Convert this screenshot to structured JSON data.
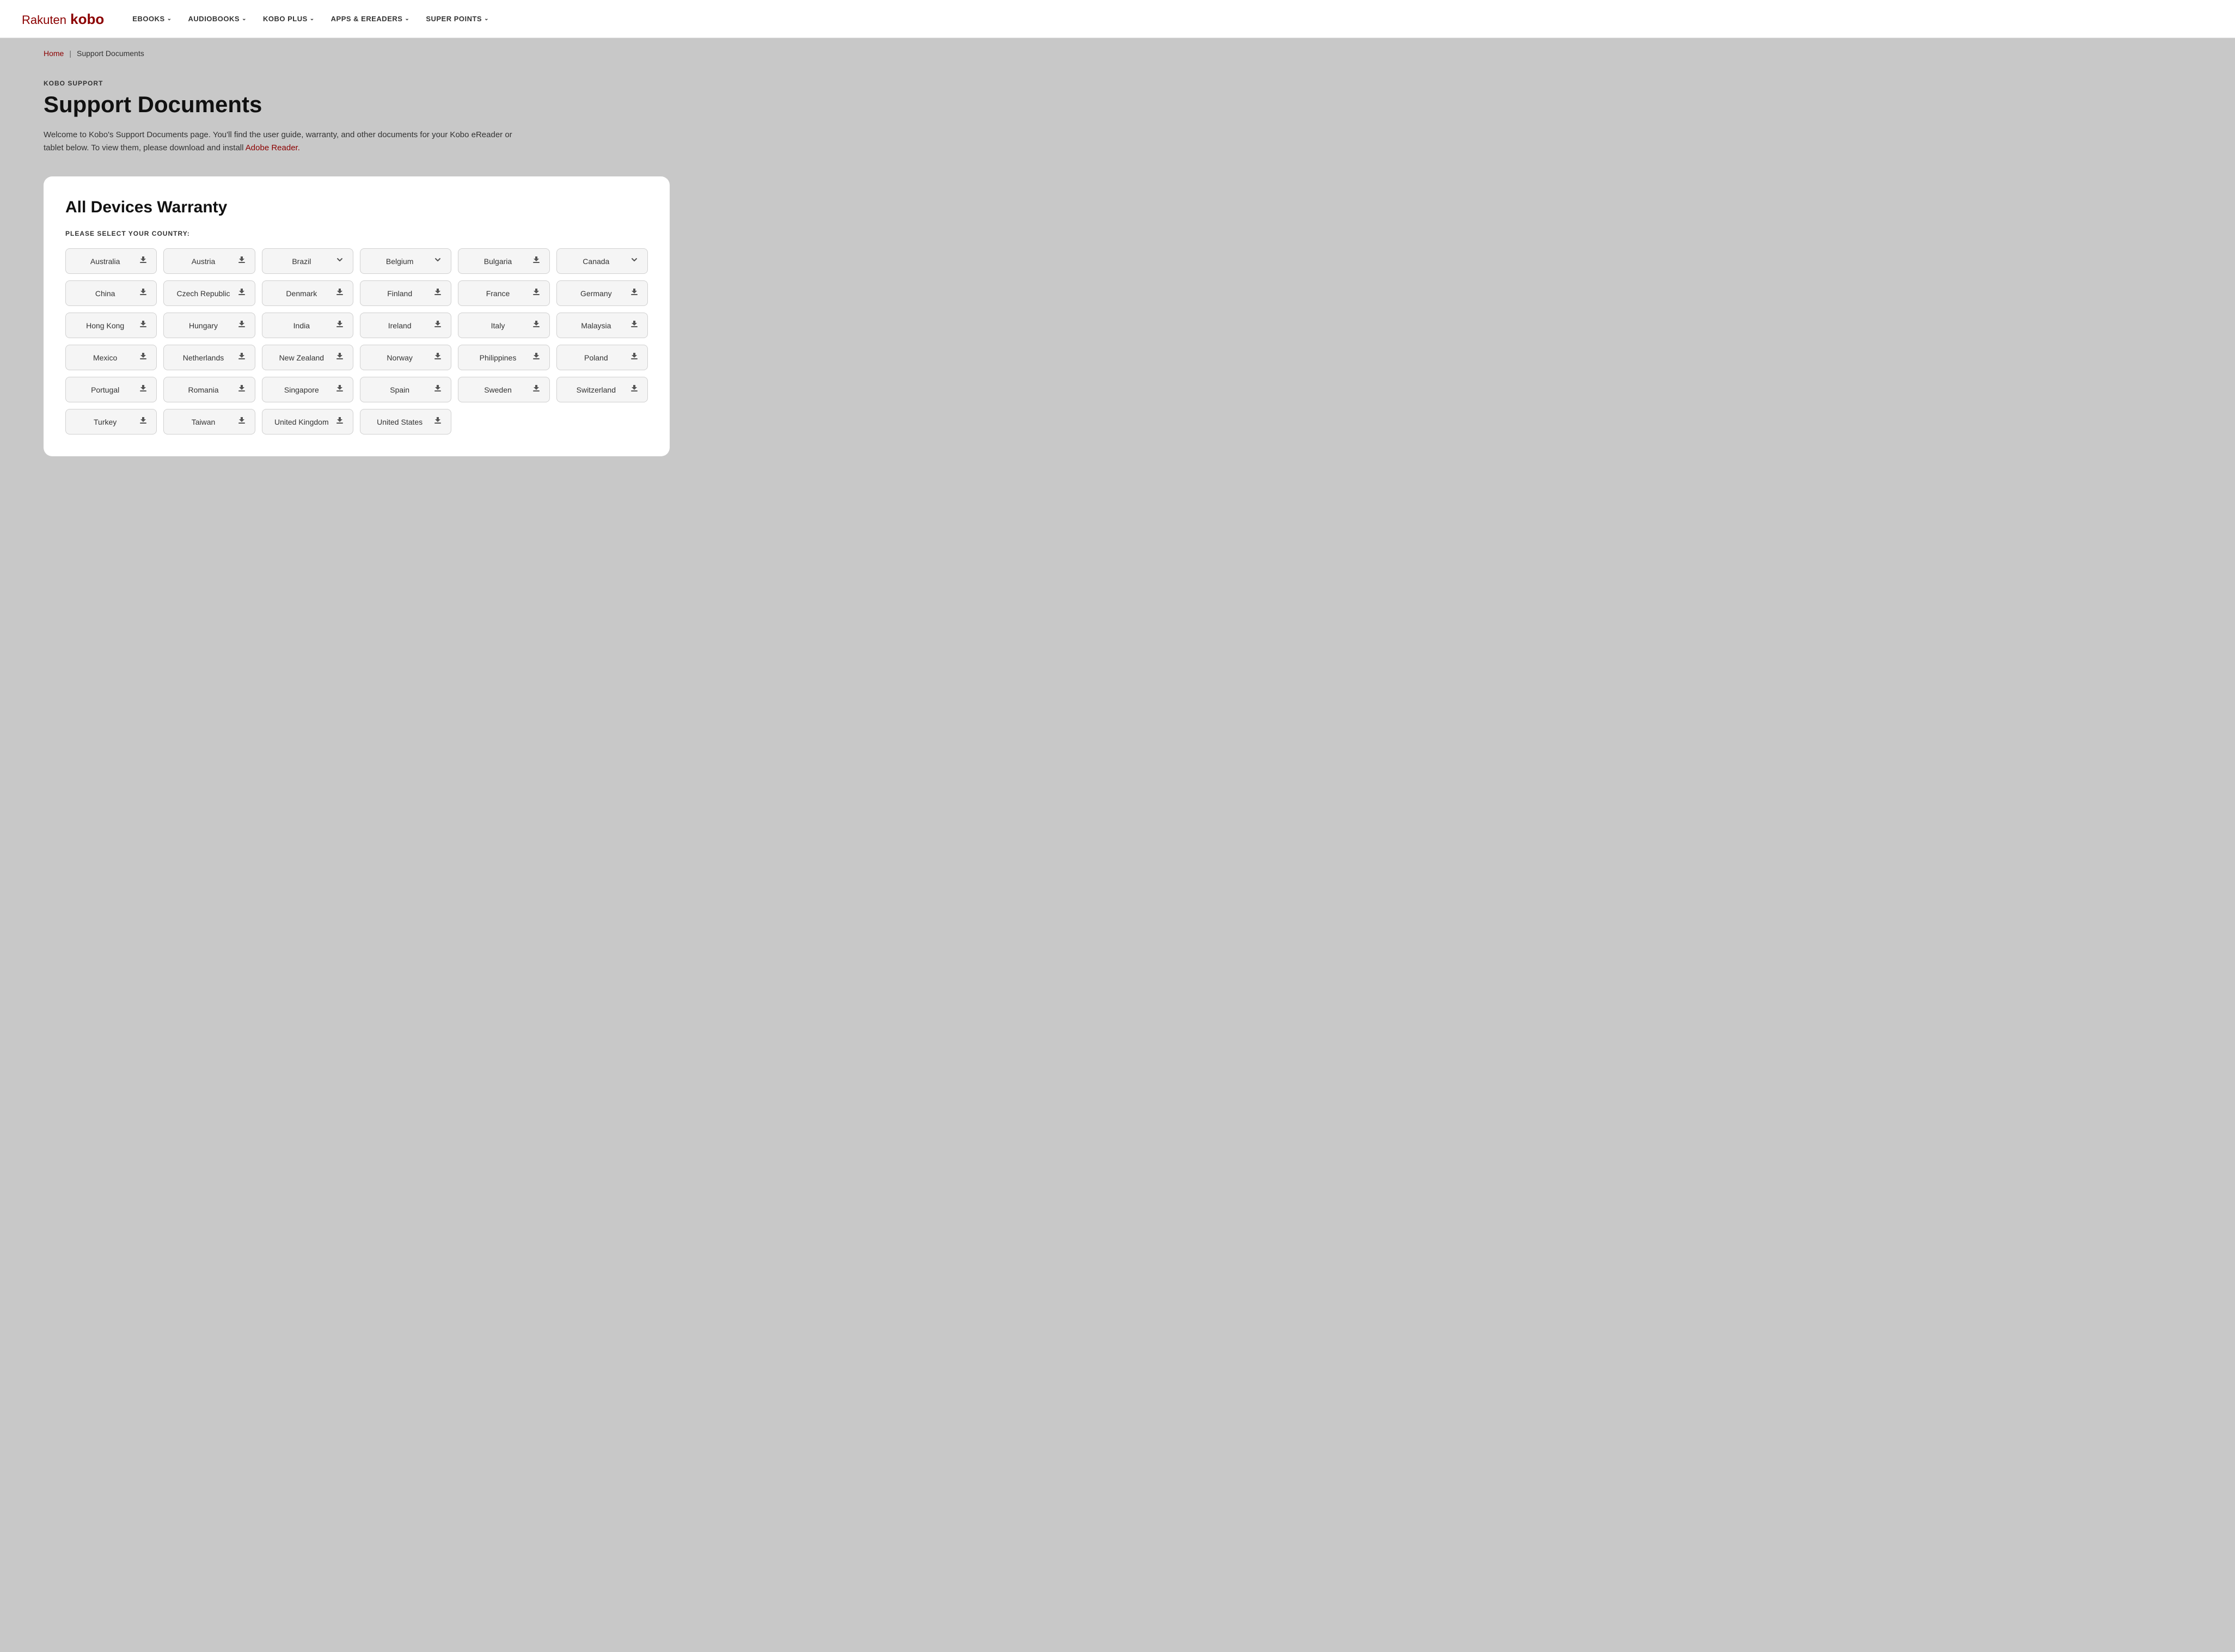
{
  "header": {
    "logo": "Rakuten kobo",
    "logo_rakuten": "Rakuten",
    "logo_kobo": "kobo",
    "nav": [
      {
        "label": "eBOOKS",
        "has_arrow": true
      },
      {
        "label": "AUDIOBOOKS",
        "has_arrow": true
      },
      {
        "label": "KOBO PLUS",
        "has_arrow": true
      },
      {
        "label": "APPS & eREADERS",
        "has_arrow": true
      },
      {
        "label": "SUPER POINTS",
        "has_arrow": true
      }
    ]
  },
  "breadcrumb": {
    "home": "Home",
    "separator": "|",
    "current": "Support Documents"
  },
  "page": {
    "subtitle": "KOBO SUPPORT",
    "title": "Support Documents",
    "description_part1": "Welcome to Kobo's Support Documents page. You'll find the user guide, warranty, and other documents for your Kobo eReader or tablet below. To view them, please download and install ",
    "description_link": "Adobe Reader.",
    "description_part2": ""
  },
  "card": {
    "title": "All Devices Warranty",
    "select_label": "PLEASE SELECT YOUR COUNTRY:",
    "countries": [
      {
        "name": "Australia",
        "icon": "download"
      },
      {
        "name": "Austria",
        "icon": "download"
      },
      {
        "name": "Brazil",
        "icon": "chevron-down"
      },
      {
        "name": "Belgium",
        "icon": "chevron-down"
      },
      {
        "name": "Bulgaria",
        "icon": "download"
      },
      {
        "name": "Canada",
        "icon": "chevron-down"
      },
      {
        "name": "China",
        "icon": "download"
      },
      {
        "name": "Czech Republic",
        "icon": "download"
      },
      {
        "name": "Denmark",
        "icon": "download"
      },
      {
        "name": "Finland",
        "icon": "download"
      },
      {
        "name": "France",
        "icon": "download"
      },
      {
        "name": "Germany",
        "icon": "download"
      },
      {
        "name": "Hong Kong",
        "icon": "download"
      },
      {
        "name": "Hungary",
        "icon": "download"
      },
      {
        "name": "India",
        "icon": "download"
      },
      {
        "name": "Ireland",
        "icon": "download"
      },
      {
        "name": "Italy",
        "icon": "download"
      },
      {
        "name": "Malaysia",
        "icon": "download"
      },
      {
        "name": "Mexico",
        "icon": "download"
      },
      {
        "name": "Netherlands",
        "icon": "download"
      },
      {
        "name": "New Zealand",
        "icon": "download"
      },
      {
        "name": "Norway",
        "icon": "download"
      },
      {
        "name": "Philippines",
        "icon": "download"
      },
      {
        "name": "Poland",
        "icon": "download"
      },
      {
        "name": "Portugal",
        "icon": "download"
      },
      {
        "name": "Romania",
        "icon": "download"
      },
      {
        "name": "Singapore",
        "icon": "download"
      },
      {
        "name": "Spain",
        "icon": "download"
      },
      {
        "name": "Sweden",
        "icon": "download"
      },
      {
        "name": "Switzerland",
        "icon": "download"
      },
      {
        "name": "Turkey",
        "icon": "download"
      },
      {
        "name": "Taiwan",
        "icon": "download"
      },
      {
        "name": "United Kingdom",
        "icon": "download"
      },
      {
        "name": "United States",
        "icon": "download"
      }
    ],
    "icons": {
      "download": "⬇",
      "chevron-down": "⌄"
    }
  }
}
